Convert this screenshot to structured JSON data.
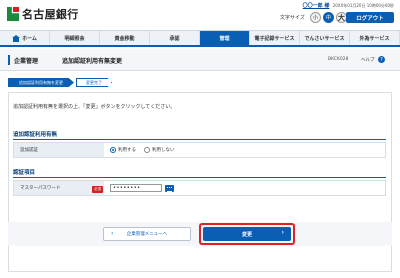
{
  "header": {
    "bank_name": "名古屋銀行",
    "user_name": "〇〇一郎 様",
    "last_login": "20XX年01月20日 10時00分00秒",
    "font_size_label": "文字サイズ",
    "font_sizes": [
      "小",
      "中",
      "大"
    ],
    "font_size_selected": "中",
    "logout_label": "ログアウト"
  },
  "nav": {
    "items": [
      {
        "label": "ホーム",
        "active": false
      },
      {
        "label": "明細照会",
        "active": false
      },
      {
        "label": "資金移動",
        "active": false
      },
      {
        "label": "承認",
        "active": false
      },
      {
        "label": "管理",
        "active": true
      },
      {
        "label": "電子記録サービス",
        "active": false
      },
      {
        "label": "でんさいサービス",
        "active": false
      },
      {
        "label": "外為サービス",
        "active": false
      }
    ]
  },
  "title": {
    "category": "企業管理",
    "page": "追加認証利用有無変更",
    "screen_code": "BKCK028",
    "help_label": "ヘルプ",
    "help_icon": "question-icon"
  },
  "steps": {
    "current": "追加認証利用有無を変更",
    "next": "変更完了"
  },
  "intro_text": "追加認証利用有無を選択の上、「変更」ボタンをクリックしてください。",
  "usage_section": {
    "heading": "追加認証利用有無",
    "row_label": "追加認証",
    "options": [
      "利用する",
      "利用しない"
    ],
    "selected": "利用する"
  },
  "auth_section": {
    "heading": "認証項目",
    "row_label": "マスターパスワード",
    "required_badge": "必須",
    "password_value": "••••••••",
    "keyboard_icon": "software-keyboard-icon"
  },
  "buttons": {
    "back_label": "企業管理メニューへ",
    "change_label": "変更"
  },
  "colors": {
    "primary": "#0a5fb4",
    "required": "#d81f26",
    "highlight_border": "#e0202a",
    "brand_green": "#1a8a3c"
  }
}
